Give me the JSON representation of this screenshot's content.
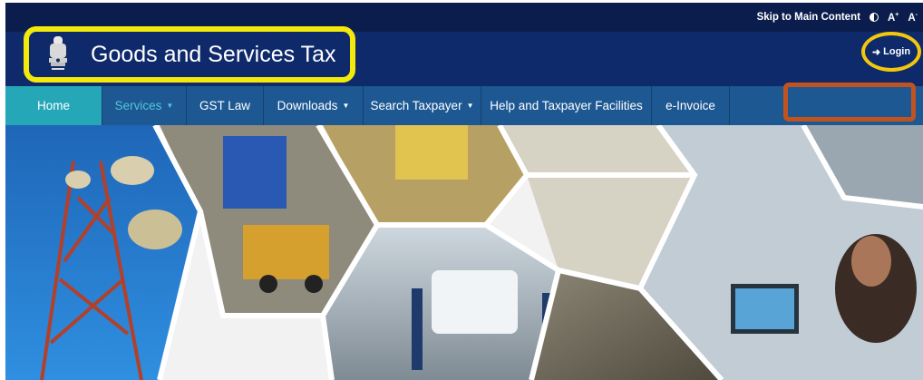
{
  "topbar": {
    "skip_label": "Skip to Main Content",
    "contrast_icon": "contrast-icon",
    "font_increase": "A+",
    "font_decrease": "A-"
  },
  "header": {
    "title": "Goods and Services Tax",
    "login_label": "Login",
    "login_icon": "login-icon"
  },
  "nav": {
    "items": [
      {
        "label": "Home"
      },
      {
        "label": "Services"
      },
      {
        "label": "GST Law"
      },
      {
        "label": "Downloads"
      },
      {
        "label": "Search Taxpayer"
      },
      {
        "label": "Help and Taxpayer Facilities"
      },
      {
        "label": "e-Invoice"
      }
    ]
  },
  "colors": {
    "topbar": "#0b1d4d",
    "header": "#0f2a6b",
    "nav": "#1d5893",
    "home_active": "#25a7b7",
    "highlight_yellow": "#f3ea0b",
    "highlight_orange": "#c0531e"
  }
}
